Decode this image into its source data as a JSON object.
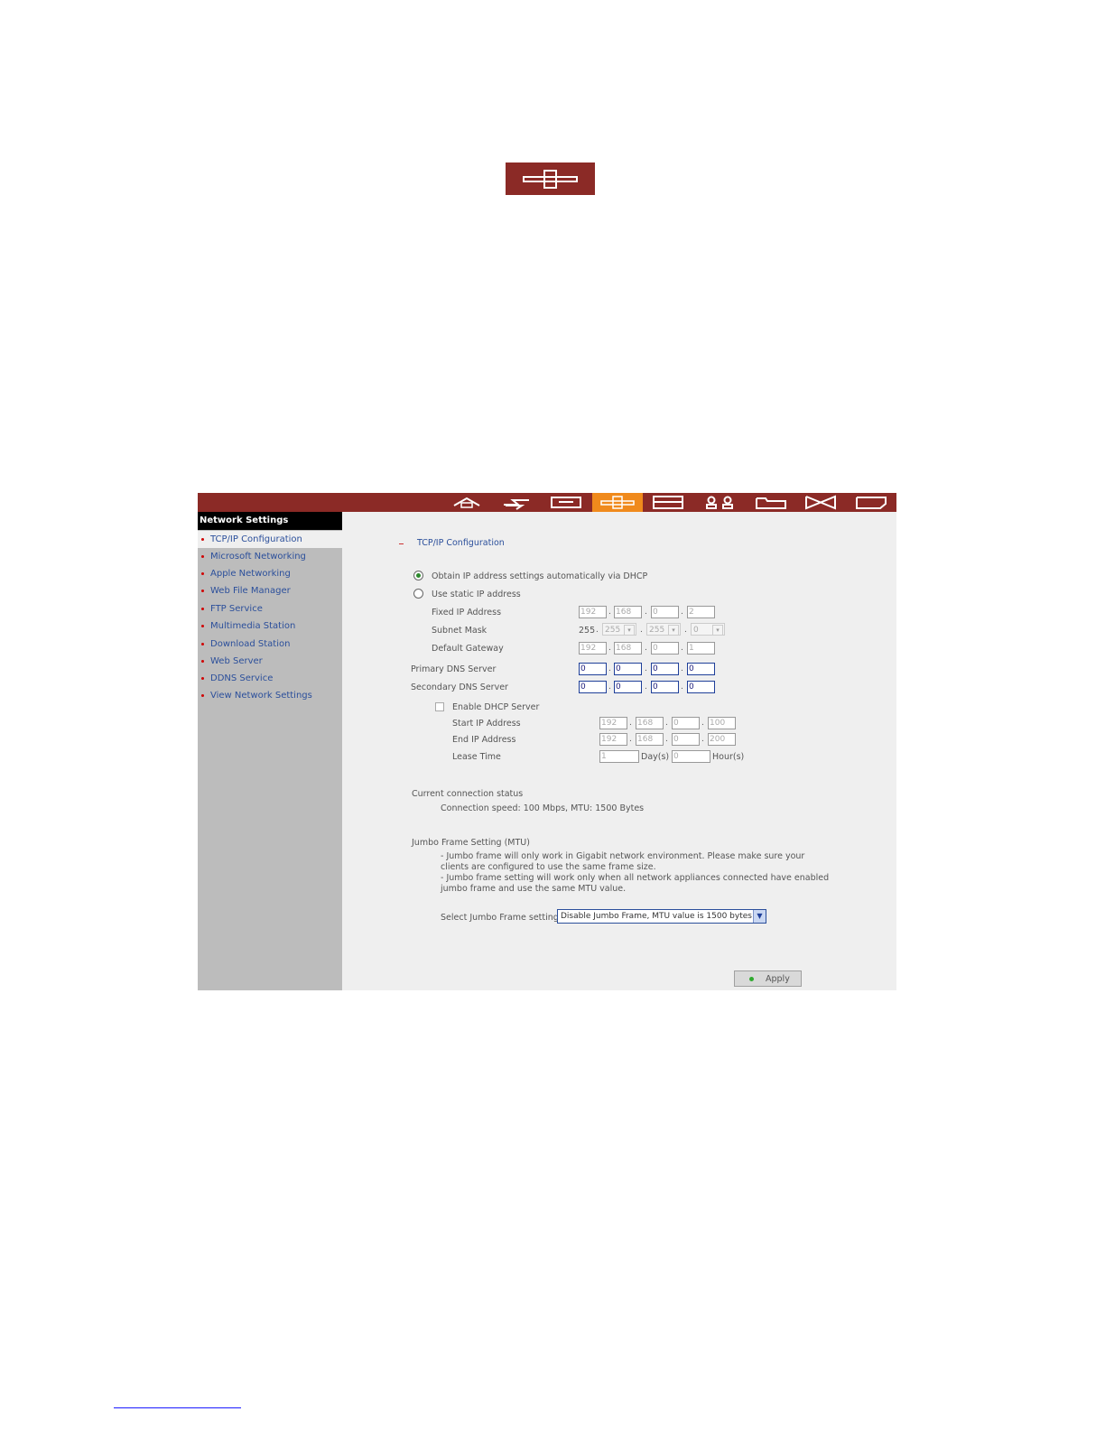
{
  "banner": {
    "icon": "network-icon",
    "color": "#8b2a26"
  },
  "topbar": {
    "color": "#8b2a26",
    "active_color": "#f08a1c",
    "icons": [
      "home-icon",
      "lightning-icon",
      "system-icon",
      "network-icon",
      "storage-icon",
      "users-icon",
      "folder-icon",
      "tools-icon",
      "log-icon"
    ],
    "active_index": 3
  },
  "sidebar": {
    "title": "Network Settings",
    "items": [
      {
        "label": "TCP/IP Configuration"
      },
      {
        "label": "Microsoft Networking"
      },
      {
        "label": "Apple Networking"
      },
      {
        "label": "Web File Manager"
      },
      {
        "label": "FTP Service"
      },
      {
        "label": "Multimedia Station"
      },
      {
        "label": "Download Station"
      },
      {
        "label": "Web Server"
      },
      {
        "label": "DDNS Service"
      },
      {
        "label": "View Network Settings"
      }
    ]
  },
  "main": {
    "section_title": "TCP/IP Configuration",
    "radio_dhcp": "Obtain IP address settings automatically via DHCP",
    "radio_static": "Use static IP address",
    "fixed_ip_label": "Fixed IP Address",
    "fixed_ip": [
      "192",
      "168",
      "0",
      "2"
    ],
    "subnet_label": "Subnet Mask",
    "subnet": [
      "255",
      "255",
      "255",
      "0"
    ],
    "gateway_label": "Default Gateway",
    "gateway": [
      "192",
      "168",
      "0",
      "1"
    ],
    "primary_dns_label": "Primary DNS Server",
    "primary_dns": [
      "0",
      "0",
      "0",
      "0"
    ],
    "secondary_dns_label": "Secondary DNS Server",
    "secondary_dns": [
      "0",
      "0",
      "0",
      "0"
    ],
    "dhcp_server_label": "Enable DHCP Server",
    "start_ip_label": "Start IP Address",
    "start_ip": [
      "192",
      "168",
      "0",
      "100"
    ],
    "end_ip_label": "End IP Address",
    "end_ip": [
      "192",
      "168",
      "0",
      "200"
    ],
    "lease_label": "Lease Time",
    "lease_days": "1",
    "lease_days_unit": "Day(s)",
    "lease_hours": "0",
    "lease_hours_unit": "Hour(s)",
    "status_label": "Current connection status",
    "status_text": "Connection speed: 100 Mbps, MTU: 1500 Bytes",
    "jumbo_title": "Jumbo Frame Setting (MTU)",
    "jumbo_note_1": "- Jumbo frame will only work in Gigabit network environment. Please make sure your",
    "jumbo_note_2": "clients are configured to use the same frame size.",
    "jumbo_note_3": "- Jumbo frame setting will work only when all network appliances connected have enabled",
    "jumbo_note_4": "jumbo frame and use the same MTU value.",
    "jumbo_select_label": "Select Jumbo Frame setting:",
    "jumbo_select_value": "Disable Jumbo Frame, MTU value is 1500 bytes",
    "apply_label": "Apply"
  }
}
